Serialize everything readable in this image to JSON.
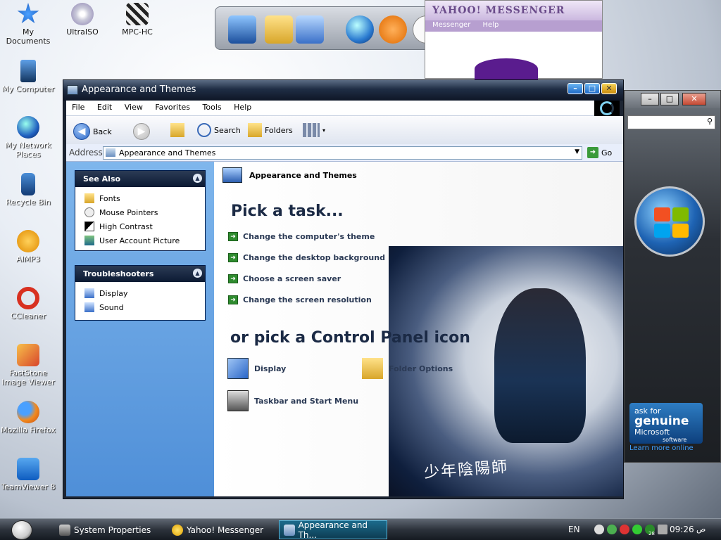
{
  "desktop": {
    "icons": [
      {
        "label": "My Documents"
      },
      {
        "label": "UltraISO"
      },
      {
        "label": "MPC-HC"
      },
      {
        "label": "My Computer"
      },
      {
        "label": "My Network Places"
      },
      {
        "label": "Recycle Bin"
      },
      {
        "label": "AIMP3"
      },
      {
        "label": "CCleaner"
      },
      {
        "label": "FastStone Image Viewer"
      },
      {
        "label": "Mozilla Firefox"
      },
      {
        "label": "TeamViewer 8"
      }
    ]
  },
  "yahoo": {
    "title": "YAHOO! MESSENGER",
    "menu": [
      "Messenger",
      "Help"
    ]
  },
  "genuine": {
    "line1": "ask for",
    "line2": "genuine",
    "line3": "Microsoft",
    "line4": "software",
    "learn": "Learn more online"
  },
  "window": {
    "title": "Appearance and Themes",
    "menu": [
      "File",
      "Edit",
      "View",
      "Favorites",
      "Tools",
      "Help"
    ],
    "toolbar": {
      "back": "Back",
      "search": "Search",
      "folders": "Folders"
    },
    "address": {
      "label": "Address",
      "value": "Appearance and Themes",
      "go": "Go"
    }
  },
  "sidebar": {
    "see_also": {
      "title": "See Also",
      "items": [
        "Fonts",
        "Mouse Pointers",
        "High Contrast",
        "User Account Picture"
      ]
    },
    "troubleshooters": {
      "title": "Troubleshooters",
      "items": [
        "Display",
        "Sound"
      ]
    }
  },
  "content": {
    "header": "Appearance and Themes",
    "pick_task": "Pick a task...",
    "tasks": [
      "Change the computer's theme",
      "Change the desktop background",
      "Choose a screen saver",
      "Change the screen resolution"
    ],
    "pick_icon": "or pick a Control Panel icon",
    "icons": [
      "Display",
      "Folder Options",
      "Taskbar and Start Menu"
    ]
  },
  "taskbar": {
    "tasks": [
      "System Properties",
      "Yahoo! Messenger",
      "Appearance and Th..."
    ],
    "lang": "EN",
    "badge": "28",
    "clock": "09:26",
    "ampm": "ص"
  },
  "colors": {
    "sidebar": "#5d9be0",
    "title_dark": "#1f2d44",
    "task_arrow": "#2e8b2e"
  }
}
